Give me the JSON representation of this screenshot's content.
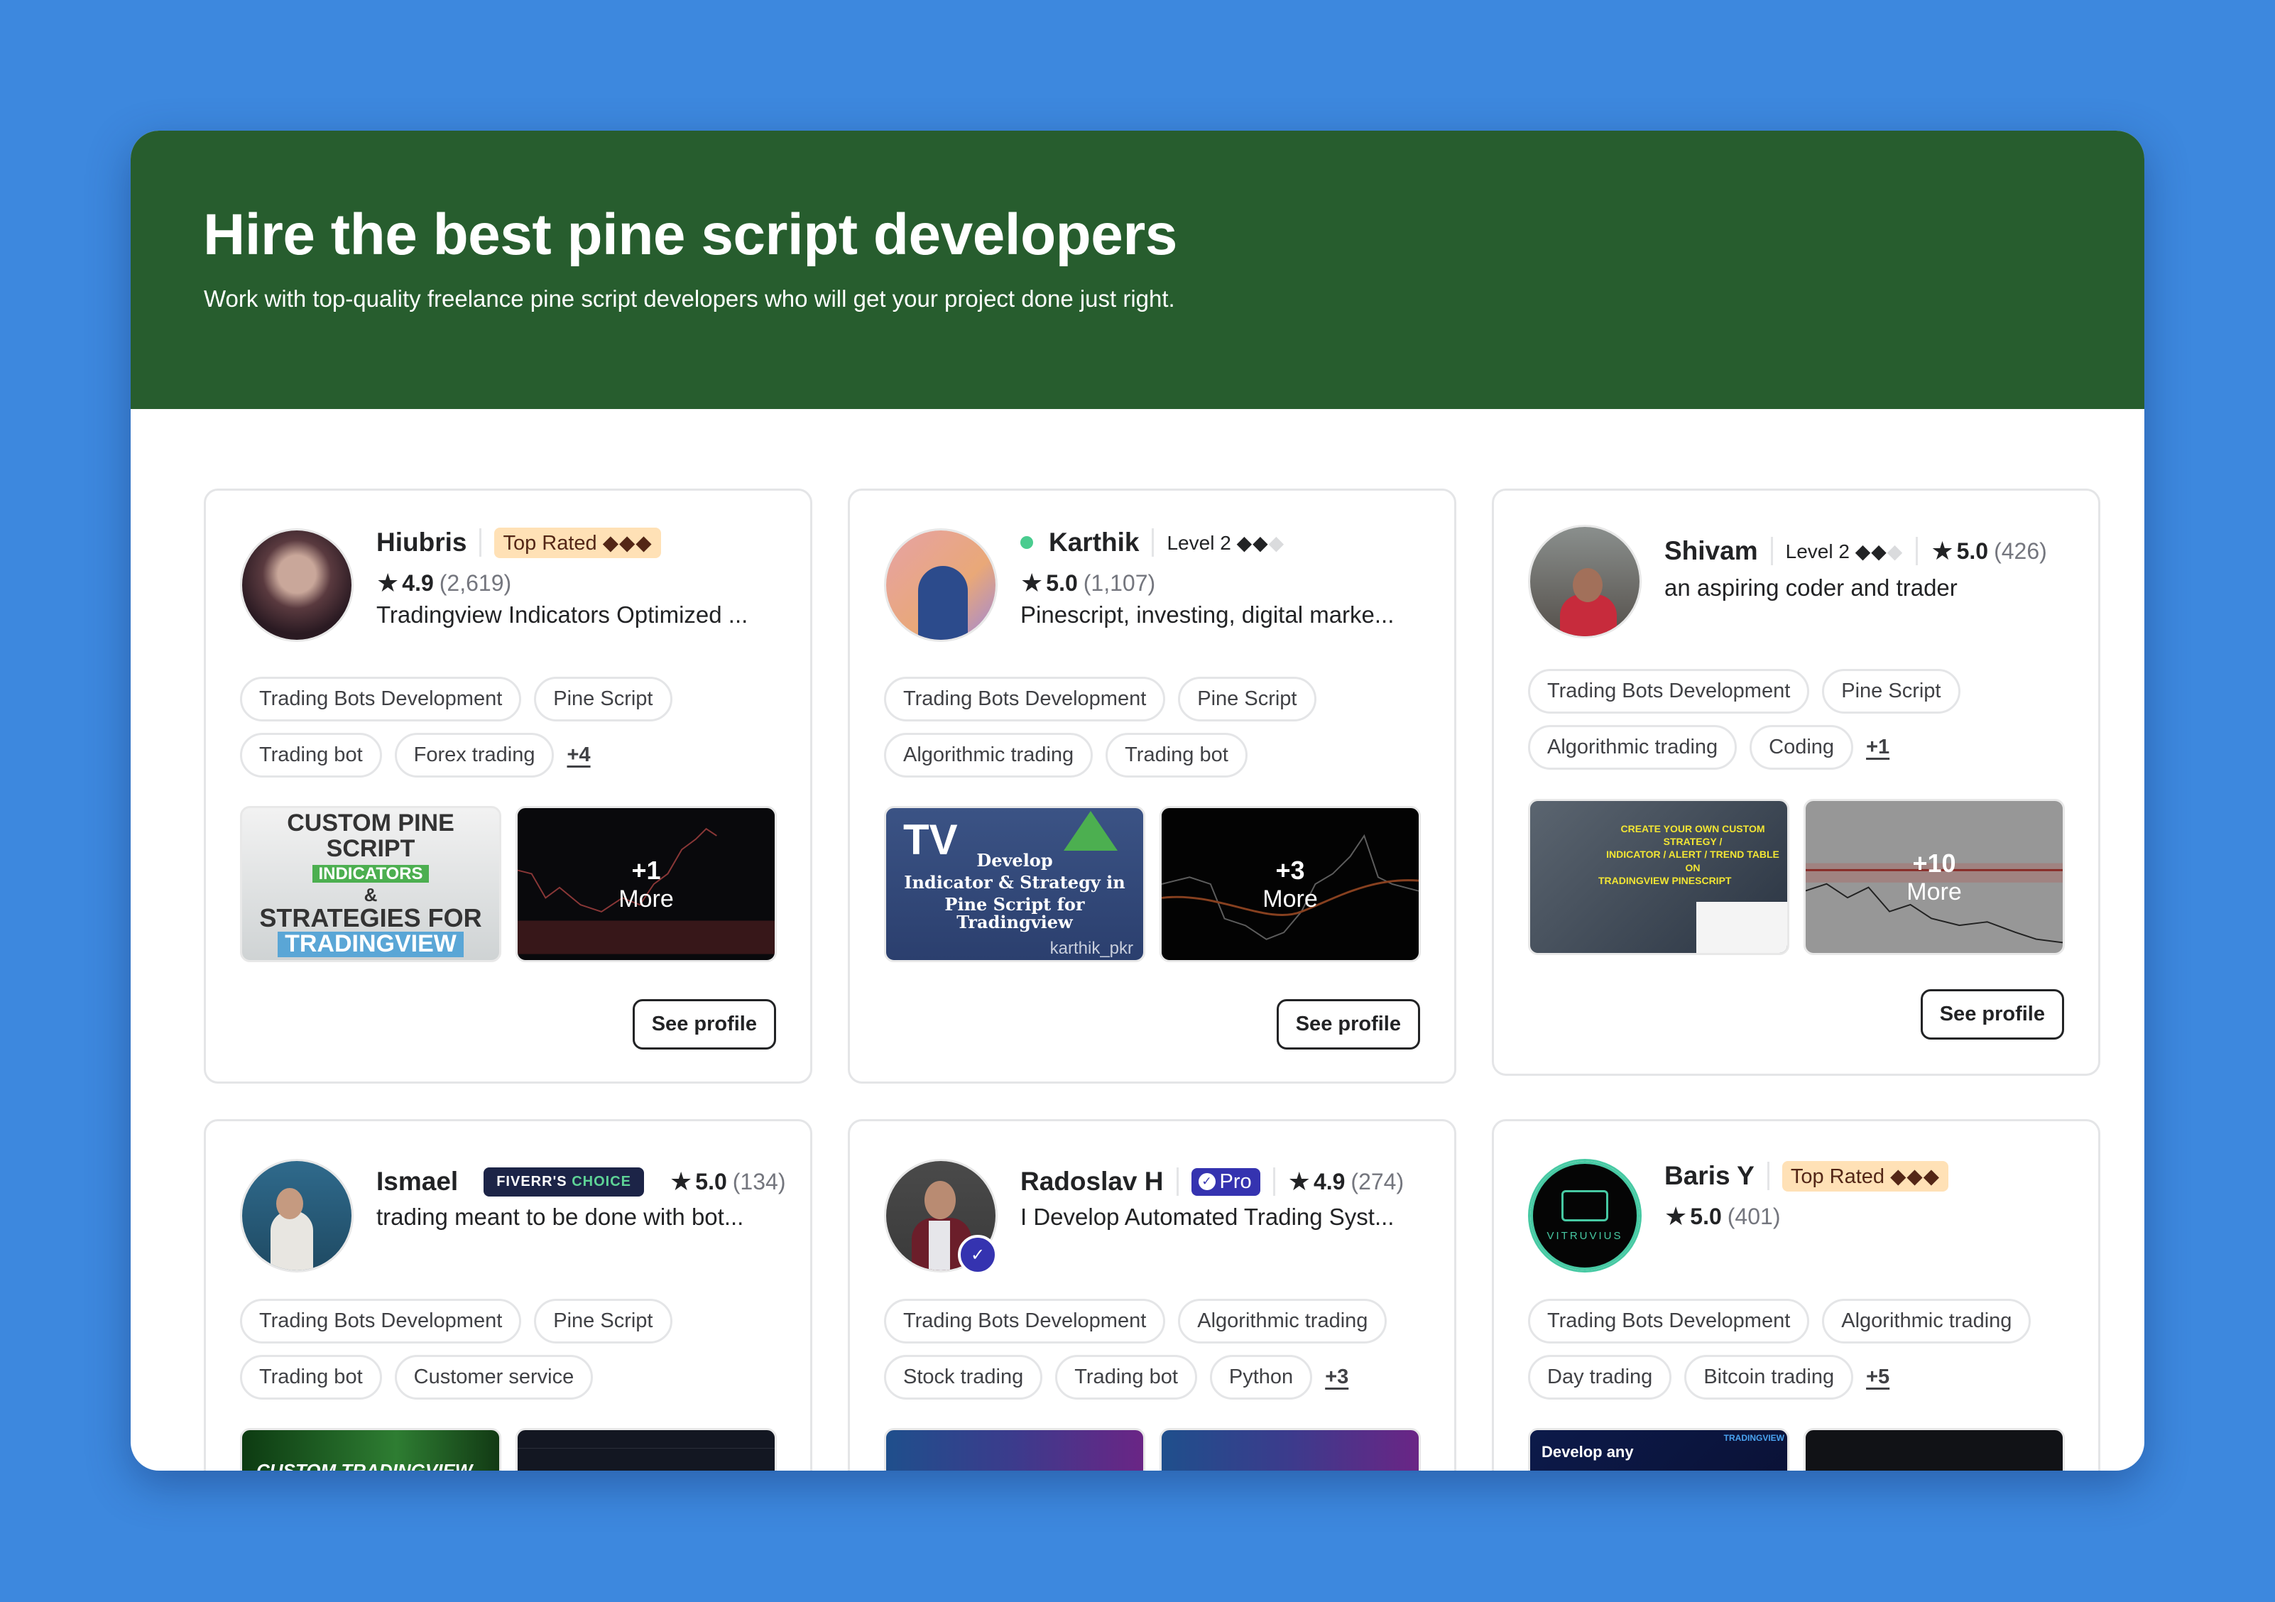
{
  "hero": {
    "title": "Hire the best pine script developers",
    "subtitle": "Work with top-quality freelance pine script developers who will get your project done just right."
  },
  "colors": {
    "page_background": "#3d88de",
    "hero_background": "#275d2e",
    "top_rated_bg": "#ffe0b3",
    "top_rated_text": "#4a1b0a",
    "fiverrs_choice_bg": "#1c2447",
    "fiverrs_choice_accent": "#5ed396",
    "pro_badge_bg": "#3533b0",
    "online_dot": "#1dbf73"
  },
  "see_profile_label": "See profile",
  "more_label": "More",
  "sellers": [
    {
      "name": "Hiubris",
      "badge_type": "top-rated",
      "badge_label": "Top Rated",
      "badge_diamonds": "◆◆◆",
      "rating": "4.9",
      "reviews": "(2,619)",
      "description": "Tradingview Indicators Optimized ...",
      "tags": [
        "Trading Bots Development",
        "Pine Script",
        "Trading bot",
        "Forex trading"
      ],
      "more_tags": "+4",
      "gallery": [
        {
          "caption_lines": [
            "CUSTOM PINE SCRIPT",
            "INDICATORS",
            "&",
            "STRATEGIES FOR",
            "TRADINGVIEW"
          ]
        },
        {
          "more_count": "+1"
        }
      ]
    },
    {
      "name": "Karthik",
      "online": true,
      "badge_type": "level",
      "badge_label": "Level 2",
      "badge_diamonds": "◆◆",
      "badge_diamonds_dim": "◆",
      "rating": "5.0",
      "reviews": "(1,107)",
      "description": "Pinescript, investing, digital marke...",
      "tags": [
        "Trading Bots Development",
        "Pine Script",
        "Algorithmic trading",
        "Trading bot"
      ],
      "gallery": [
        {
          "caption_lines": [
            "Develop",
            "Indicator & Strategy in",
            "Pine Script for Tradingview"
          ],
          "watermark": "karthik_pkr"
        },
        {
          "more_count": "+3"
        }
      ]
    },
    {
      "name": "Shivam",
      "badge_type": "level",
      "badge_label": "Level 2",
      "badge_diamonds": "◆◆",
      "badge_diamonds_dim": "◆",
      "rating": "5.0",
      "reviews": "(426)",
      "description": "an aspiring coder and trader",
      "tags": [
        "Trading Bots Development",
        "Pine Script",
        "Algorithmic trading",
        "Coding"
      ],
      "more_tags": "+1",
      "gallery": [
        {
          "caption_lines": [
            "CREATE YOUR OWN CUSTOM STRATEGY /",
            "INDICATOR / ALERT / TREND TABLE ON",
            "TRADINGVIEW PINESCRIPT"
          ]
        },
        {
          "more_count": "+10"
        }
      ]
    },
    {
      "name": "Ismael",
      "badge_type": "fiverrs-choice",
      "badge_label_a": "FIVERR'S",
      "badge_label_b": "CHOICE",
      "rating": "5.0",
      "reviews": "(134)",
      "description": "trading meant to be done with bot...",
      "tags": [
        "Trading Bots Development",
        "Pine Script",
        "Trading bot",
        "Customer service"
      ],
      "gallery": [
        {
          "caption_lines": [
            "CUSTOM TRADINGVIEW"
          ]
        },
        {
          "caption_lines": []
        }
      ]
    },
    {
      "name": "Radoslav H",
      "verified": true,
      "badge_type": "pro",
      "badge_label": "Pro",
      "rating": "4.9",
      "reviews": "(274)",
      "description": "I Develop Automated Trading Syst...",
      "tags": [
        "Trading Bots Development",
        "Algorithmic trading",
        "Stock trading",
        "Trading bot",
        "Python"
      ],
      "more_tags": "+3",
      "gallery": [
        {
          "caption_lines": []
        },
        {
          "caption_lines": []
        }
      ]
    },
    {
      "name": "Baris Y",
      "badge_type": "top-rated",
      "badge_label": "Top Rated",
      "badge_diamonds": "◆◆◆",
      "avatar_text": "VITRUVIUS",
      "rating": "5.0",
      "reviews": "(401)",
      "description": "",
      "tags": [
        "Trading Bots Development",
        "Algorithmic trading",
        "Day trading",
        "Bitcoin trading"
      ],
      "more_tags": "+5",
      "gallery": [
        {
          "caption_lines": [
            "Develop any"
          ],
          "label": "TRADINGVIEW"
        },
        {
          "caption_lines": []
        }
      ]
    }
  ]
}
